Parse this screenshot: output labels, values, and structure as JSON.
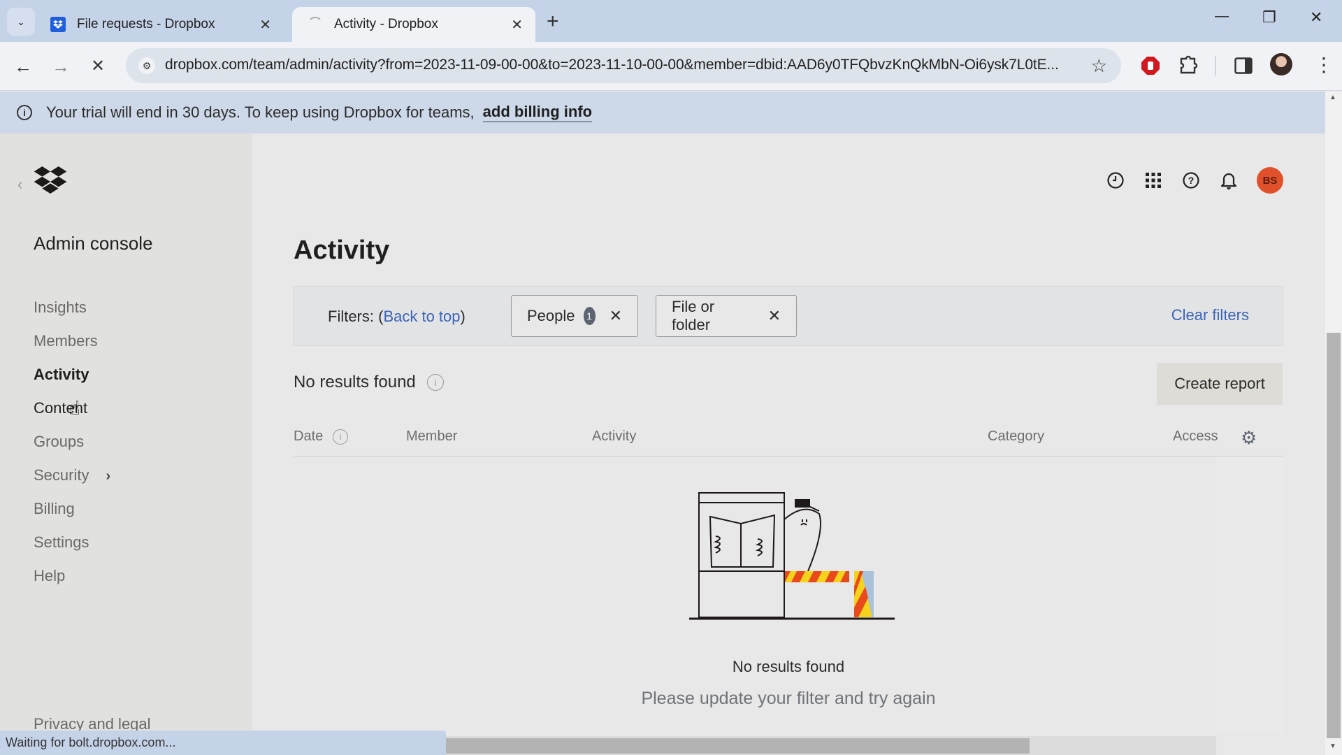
{
  "browser": {
    "tabs": [
      {
        "title": "File requests - Dropbox",
        "active": false
      },
      {
        "title": "Activity - Dropbox",
        "active": true
      }
    ],
    "url": "dropbox.com/team/admin/activity?from=2023-11-09-00-00&to=2023-11-10-00-00&member=dbid:AAD6y0TFQbvzKnQkMbN-Oi6ysk7L0tE...",
    "status_text": "Waiting for bolt.dropbox.com...",
    "icons": {
      "tab_search": "chevron-down-icon",
      "new_tab": "+",
      "close": "✕",
      "back": "←",
      "forward": "→",
      "stop": "✕",
      "bookmark": "☆",
      "menu": "⋮",
      "minimize": "—",
      "restore": "❐",
      "window_close": "✕"
    }
  },
  "banner": {
    "message": "Your trial will end in 30 days. To keep using Dropbox for teams,",
    "link": "add billing info"
  },
  "sidebar": {
    "title": "Admin console",
    "items": [
      {
        "label": "Insights"
      },
      {
        "label": "Members"
      },
      {
        "label": "Activity",
        "active": true
      },
      {
        "label": "Content"
      },
      {
        "label": "Groups"
      },
      {
        "label": "Security",
        "has_submenu": true
      },
      {
        "label": "Billing"
      },
      {
        "label": "Settings"
      },
      {
        "label": "Help"
      }
    ],
    "footer_link": "Privacy and legal"
  },
  "header": {
    "avatar_initials": "BS",
    "avatar_color": "#e0502a"
  },
  "main": {
    "page_title": "Activity",
    "filters": {
      "label_prefix": "Filters: (",
      "back_to_top": "Back to top",
      "label_suffix": ")",
      "chips": [
        {
          "label": "People",
          "count": "1"
        },
        {
          "label": "File or folder"
        }
      ],
      "clear_filters": "Clear filters"
    },
    "results_title": "No results found",
    "create_report": "Create report",
    "columns": [
      "Date",
      "Member",
      "Activity",
      "Category",
      "Access"
    ],
    "empty_state": {
      "title": "No results found",
      "subtitle": "Please update your filter and try again"
    }
  },
  "colors": {
    "link": "#3b63b8",
    "banner_bg": "#cdd9e9",
    "sidebar_bg": "#e1e1df",
    "main_bg": "#e8e8e8"
  }
}
